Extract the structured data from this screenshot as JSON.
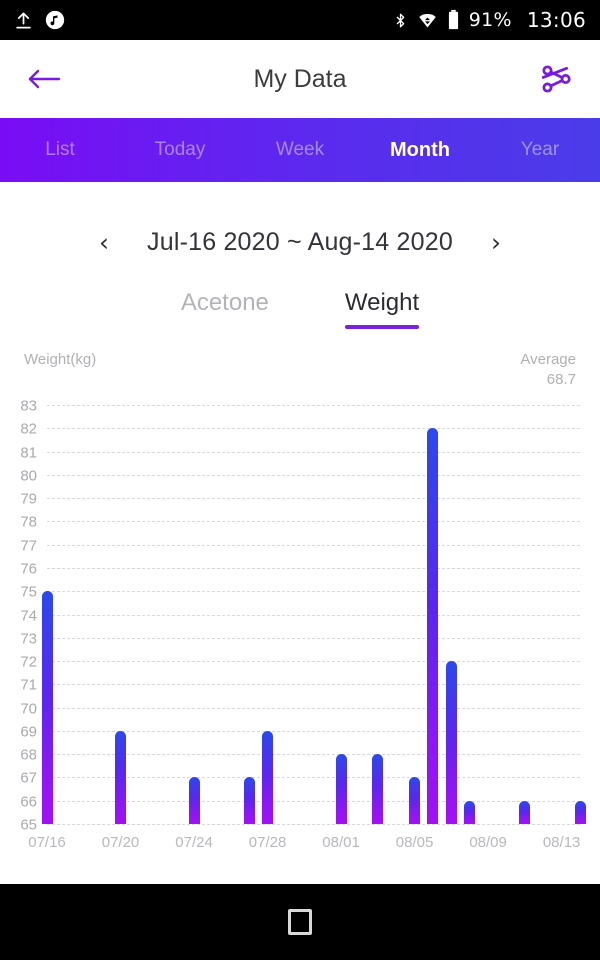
{
  "statusbar": {
    "icons_left": [
      "upload-icon",
      "music-note-icon"
    ],
    "icons_right": [
      "bluetooth-icon",
      "wifi-icon",
      "battery-icon"
    ],
    "battery_percent": "91%",
    "time": "13:06"
  },
  "appbar": {
    "back_icon": "back-arrow-icon",
    "title": "My Data",
    "share_icon": "share-icon",
    "accent_color": "#7a1ae0"
  },
  "tabs": {
    "items": [
      {
        "label": "List",
        "active": false
      },
      {
        "label": "Today",
        "active": false
      },
      {
        "label": "Week",
        "active": false
      },
      {
        "label": "Month",
        "active": true
      },
      {
        "label": "Year",
        "active": false
      }
    ],
    "gradient_from": "#7a0cf5",
    "gradient_to": "#4b3ce9"
  },
  "date_nav": {
    "prev_icon": "chevron-left-icon",
    "range": "Jul-16 2020 ~ Aug-14 2020",
    "next_icon": "chevron-right-icon"
  },
  "subtabs": {
    "items": [
      {
        "label": "Acetone",
        "active": false
      },
      {
        "label": "Weight",
        "active": true
      }
    ],
    "underline_color": "#7b22d8"
  },
  "chart_header": {
    "axis_title": "Weight(kg)",
    "average_label": "Average",
    "average_value": "68.7"
  },
  "navbar": {
    "recents_icon": "square-recents-icon"
  },
  "chart_data": {
    "type": "bar",
    "title": "Weight(kg)",
    "xlabel": "",
    "ylabel": "Weight(kg)",
    "ylim": [
      65,
      83
    ],
    "ytick_step": 1,
    "yticks": [
      83,
      82,
      81,
      80,
      79,
      78,
      77,
      76,
      75,
      74,
      73,
      72,
      71,
      70,
      69,
      68,
      67,
      66,
      65
    ],
    "grid": true,
    "legend": "none",
    "average": 68.7,
    "x_start": "07/16",
    "x_end": "08/14",
    "xtick_labels": [
      "07/16",
      "07/20",
      "07/24",
      "07/28",
      "08/01",
      "08/05",
      "08/09",
      "08/13"
    ],
    "xtick_days": [
      0,
      4,
      8,
      12,
      16,
      20,
      24,
      28
    ],
    "bar_color_top": "#2b49ee",
    "bar_color_bottom": "#a40ff6",
    "categories": [
      "07/16",
      "07/17",
      "07/18",
      "07/19",
      "07/20",
      "07/21",
      "07/22",
      "07/23",
      "07/24",
      "07/25",
      "07/26",
      "07/27",
      "07/28",
      "07/29",
      "07/30",
      "07/31",
      "08/01",
      "08/02",
      "08/03",
      "08/04",
      "08/05",
      "08/06",
      "08/07",
      "08/08",
      "08/09",
      "08/10",
      "08/11",
      "08/12",
      "08/13",
      "08/14"
    ],
    "points": [
      {
        "day": 0,
        "label": "07/16",
        "value": 75
      },
      {
        "day": 4,
        "label": "07/20",
        "value": 69
      },
      {
        "day": 8,
        "label": "07/24",
        "value": 67
      },
      {
        "day": 11,
        "label": "07/27",
        "value": 67
      },
      {
        "day": 12,
        "label": "07/28",
        "value": 69
      },
      {
        "day": 16,
        "label": "08/01",
        "value": 68
      },
      {
        "day": 18,
        "label": "08/03",
        "value": 68
      },
      {
        "day": 20,
        "label": "08/05",
        "value": 67
      },
      {
        "day": 21,
        "label": "08/06",
        "value": 82
      },
      {
        "day": 22,
        "label": "08/07",
        "value": 72
      },
      {
        "day": 23,
        "label": "08/08",
        "value": 66
      },
      {
        "day": 26,
        "label": "08/11",
        "value": 66
      },
      {
        "day": 29,
        "label": "08/14",
        "value": 66
      }
    ]
  }
}
